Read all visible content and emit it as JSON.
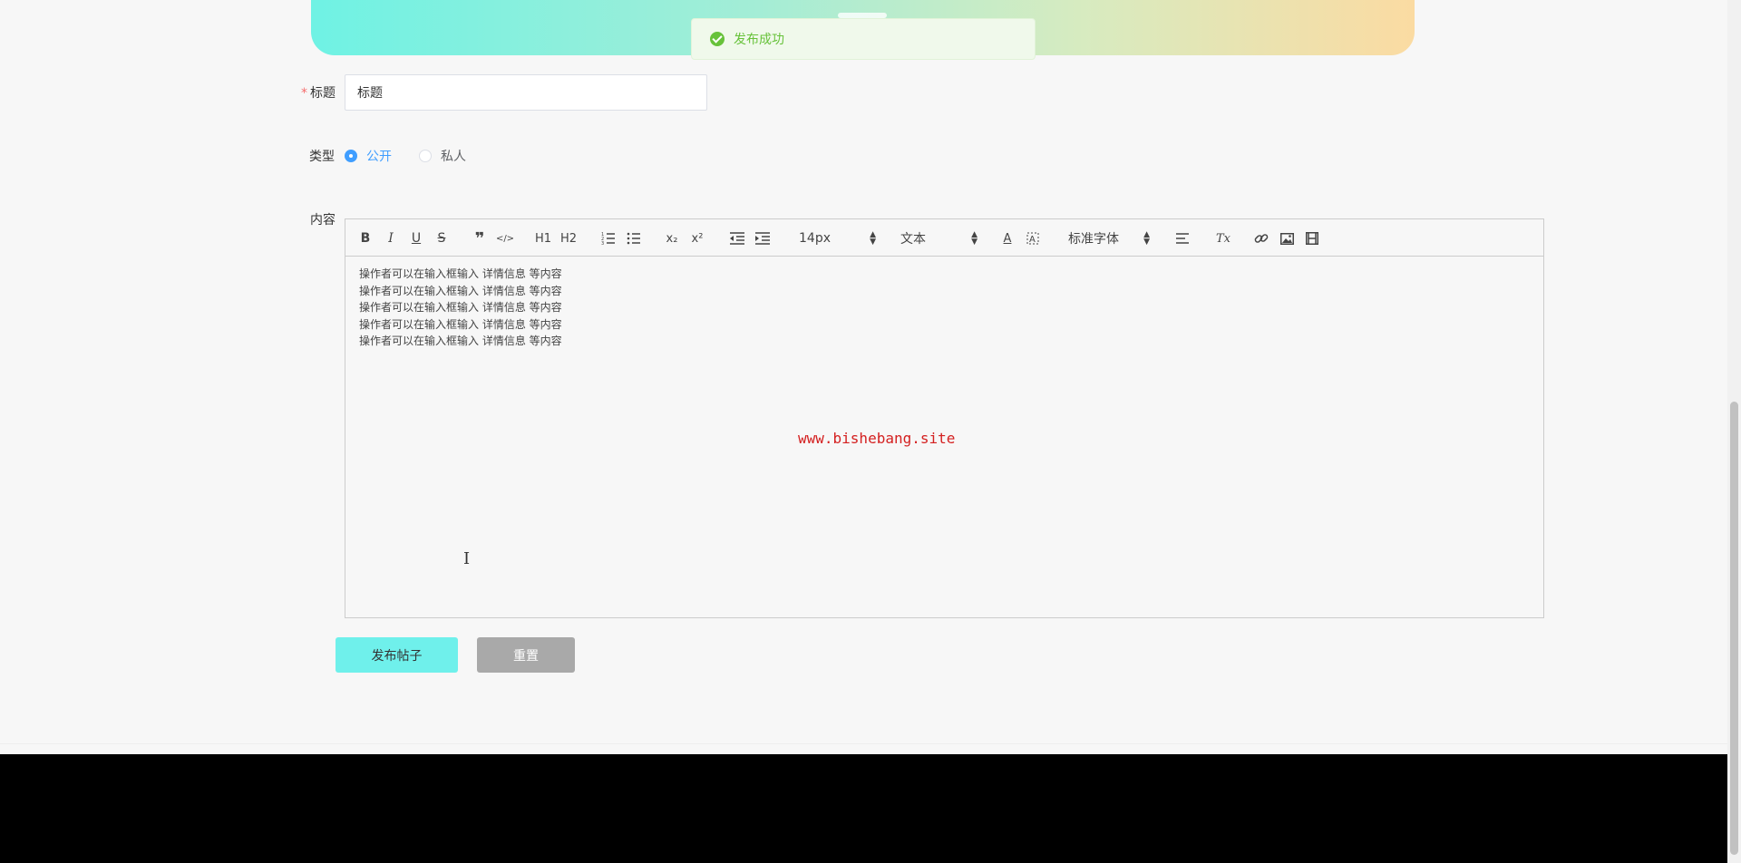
{
  "toast": {
    "message": "发布成功"
  },
  "form": {
    "title_label": "标题",
    "required_mark": "*",
    "title_value": "标题",
    "type_label": "类型",
    "type_options": [
      {
        "label": "公开",
        "checked": true
      },
      {
        "label": "私人",
        "checked": false
      }
    ],
    "content_label": "内容"
  },
  "editor": {
    "toolbar": {
      "bold": "B",
      "italic": "I",
      "underline": "U",
      "strike": "S",
      "blockquote": "❞",
      "code": "</>",
      "h1": "H1",
      "h2": "H2",
      "subscript": "x₂",
      "superscript": "x²",
      "size_select": "14px",
      "header_select": "文本",
      "font_select": "标准字体",
      "color_text": "A",
      "clean_text": "Tx"
    },
    "lines": [
      "操作者可以在输入框输入  详情信息  等内容",
      "操作者可以在输入框输入  详情信息  等内容",
      "操作者可以在输入框输入  详情信息  等内容",
      "操作者可以在输入框输入  详情信息  等内容",
      "操作者可以在输入框输入  详情信息  等内容"
    ],
    "watermark": "www.bishebang.site",
    "cursor_glyph": "I"
  },
  "buttons": {
    "publish": "发布帖子",
    "reset": "重置"
  },
  "colors": {
    "accent": "#6ff0eb",
    "primary_blue": "#409eff",
    "success_green": "#67c23a",
    "watermark_red": "#d42020"
  }
}
